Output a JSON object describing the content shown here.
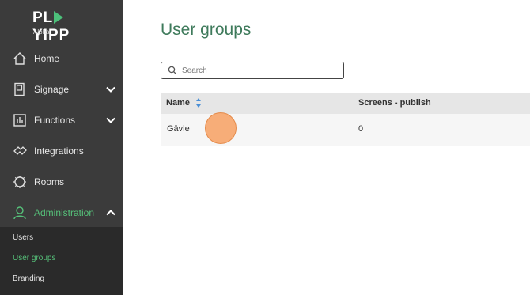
{
  "brand": {
    "logo_text_1": "PL",
    "logo_text_2": "YIPP",
    "subtitle": "Alpha"
  },
  "sidebar": {
    "items": [
      {
        "label": "Home",
        "icon": "home-icon"
      },
      {
        "label": "Signage",
        "icon": "signage-icon"
      },
      {
        "label": "Functions",
        "icon": "functions-icon"
      },
      {
        "label": "Integrations",
        "icon": "integrations-icon"
      },
      {
        "label": "Rooms",
        "icon": "rooms-icon"
      },
      {
        "label": "Administration",
        "icon": "user-icon"
      }
    ],
    "submenu": [
      {
        "label": "Users"
      },
      {
        "label": "User groups"
      },
      {
        "label": "Branding"
      }
    ],
    "accent_color": "#56c27a"
  },
  "main": {
    "title": "User groups",
    "search": {
      "placeholder": "Search",
      "value": ""
    },
    "table": {
      "columns": [
        "Name",
        "Screens - publish"
      ],
      "rows": [
        {
          "name": "Gävle",
          "screens_publish": "0"
        }
      ]
    }
  }
}
